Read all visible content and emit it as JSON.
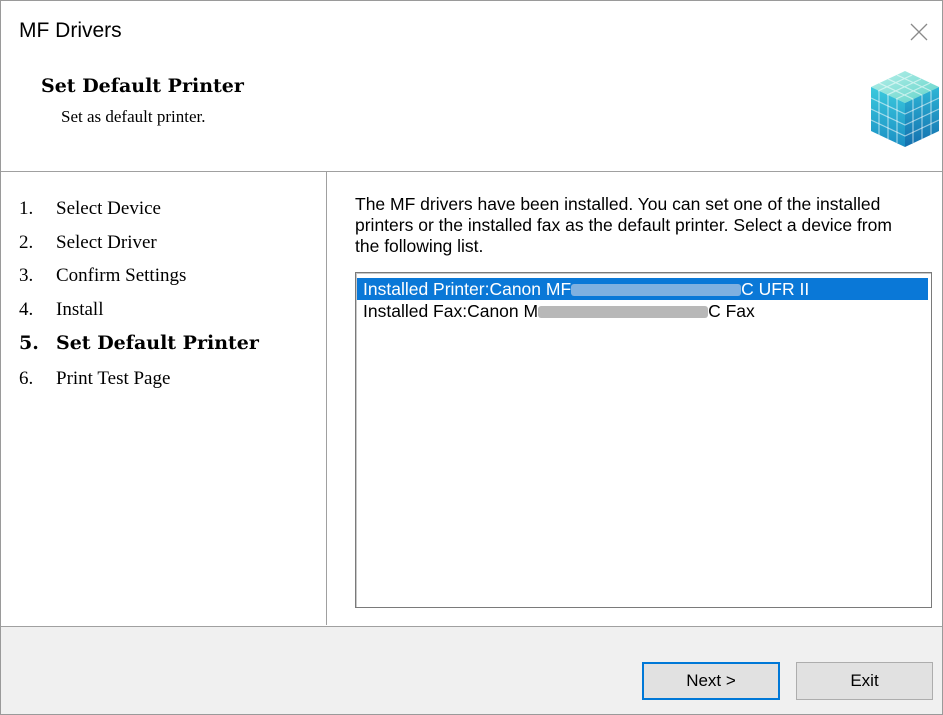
{
  "window": {
    "title": "MF Drivers"
  },
  "header": {
    "title": "Set Default Printer",
    "subtitle": "Set as default printer."
  },
  "steps": [
    {
      "num": "1.",
      "label": "Select Device",
      "active": false
    },
    {
      "num": "2.",
      "label": "Select Driver",
      "active": false
    },
    {
      "num": "3.",
      "label": "Confirm Settings",
      "active": false
    },
    {
      "num": "4.",
      "label": "Install",
      "active": false
    },
    {
      "num": "5.",
      "label": "Set Default Printer",
      "active": true
    },
    {
      "num": "6.",
      "label": "Print Test Page",
      "active": false
    }
  ],
  "content": {
    "instructions": "The MF drivers have been installed. You can set one of the installed printers or the installed fax as the default printer. Select a device from the following list.",
    "devices": [
      {
        "prefix": "Installed Printer:Canon MF",
        "suffix": "C UFR II",
        "selected": true
      },
      {
        "prefix": "Installed Fax:Canon M",
        "suffix": "C Fax",
        "selected": false
      }
    ]
  },
  "buttons": {
    "next": "Next >",
    "exit": "Exit"
  },
  "icons": {
    "close": "close-icon",
    "logo": "canon-cube-logo-icon"
  },
  "colors": {
    "selection": "#0a78d7",
    "footer_bg": "#f0f0f0",
    "default_button_border": "#0078d7"
  }
}
